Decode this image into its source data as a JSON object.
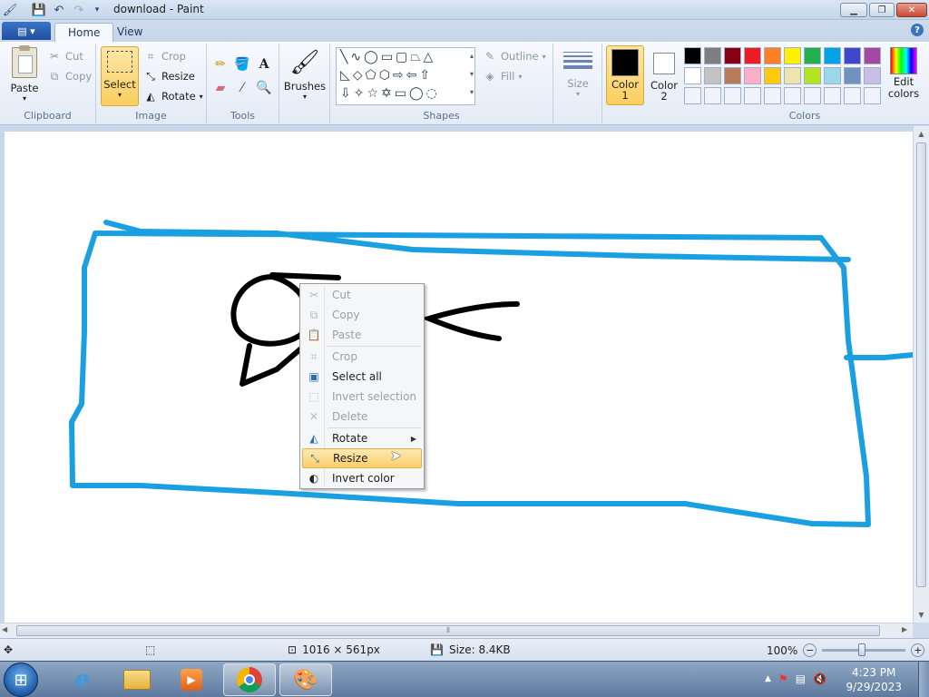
{
  "window": {
    "title": "download - Paint"
  },
  "tabs": [
    {
      "label": "Home"
    },
    {
      "label": "View"
    }
  ],
  "ribbon": {
    "clipboard": {
      "label": "Clipboard",
      "paste": "Paste",
      "cut": "Cut",
      "copy": "Copy"
    },
    "image": {
      "label": "Image",
      "select": "Select",
      "crop": "Crop",
      "resize": "Resize",
      "rotate": "Rotate"
    },
    "tools": {
      "label": "Tools"
    },
    "brushes": {
      "label": "Brushes"
    },
    "shapes": {
      "label": "Shapes",
      "outline": "Outline",
      "fill": "Fill"
    },
    "size": {
      "label": "Size"
    },
    "color1": {
      "label": "Color",
      "num": "1",
      "value": "#000000"
    },
    "color2": {
      "label": "Color",
      "num": "2",
      "value": "#ffffff"
    },
    "colors": {
      "label": "Colors",
      "edit_label": "Edit colors",
      "row1": [
        "#000000",
        "#7f7f7f",
        "#880015",
        "#ed1c24",
        "#ff7f27",
        "#fff200",
        "#22b14c",
        "#00a2e8",
        "#3f48cc",
        "#a349a4"
      ],
      "row2": [
        "#ffffff",
        "#c3c3c3",
        "#b97a57",
        "#ffaec9",
        "#ffc90e",
        "#efe4b0",
        "#b5e61d",
        "#99d9ea",
        "#7092be",
        "#c8bfe7"
      ],
      "row3": [
        "#f0f4fa",
        "#f0f4fa",
        "#f0f4fa",
        "#f0f4fa",
        "#f0f4fa",
        "#f0f4fa",
        "#f0f4fa",
        "#f0f4fa",
        "#f0f4fa",
        "#f0f4fa"
      ]
    }
  },
  "context_menu": {
    "items": [
      {
        "label": "Cut",
        "enabled": false
      },
      {
        "label": "Copy",
        "enabled": false
      },
      {
        "label": "Paste",
        "enabled": false
      },
      {
        "label": "Crop",
        "enabled": false
      },
      {
        "label": "Select all",
        "enabled": true
      },
      {
        "label": "Invert selection",
        "enabled": false
      },
      {
        "label": "Delete",
        "enabled": false
      },
      {
        "label": "Rotate",
        "enabled": true
      },
      {
        "label": "Resize",
        "enabled": true
      },
      {
        "label": "Invert color",
        "enabled": true
      }
    ]
  },
  "status": {
    "dimensions": "1016 × 561px",
    "size": "Size: 8.4KB",
    "zoom": "100%"
  },
  "taskbar": {
    "time": "4:23 PM",
    "date": "9/29/2023"
  },
  "colors": {
    "stroke_blue": "#1aa0e0",
    "stroke_black": "#000000"
  }
}
